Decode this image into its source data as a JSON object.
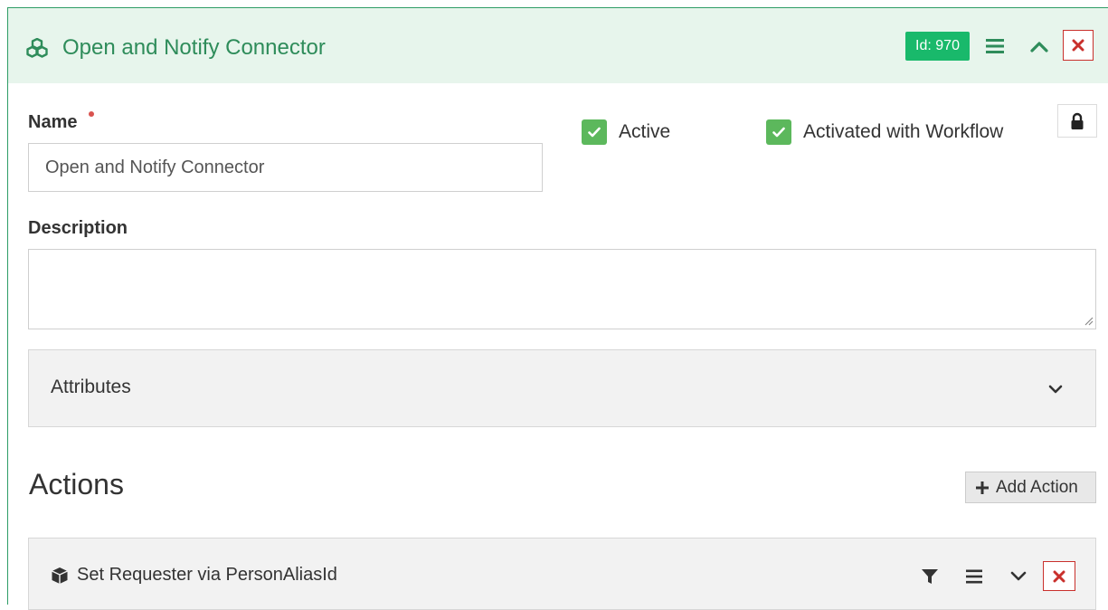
{
  "header": {
    "title": "Open and Notify Connector",
    "id_badge": "Id: 970",
    "icon": "cubes-icon",
    "accent_color": "#2e8c5a",
    "badge_color": "#19b96b"
  },
  "form": {
    "name_label": "Name",
    "name_value": "Open and Notify Connector",
    "active_label": "Active",
    "active_checked": true,
    "activated_label": "Activated with Workflow",
    "activated_checked": true,
    "description_label": "Description",
    "description_value": ""
  },
  "attributes": {
    "title": "Attributes"
  },
  "actions": {
    "heading": "Actions",
    "add_label": "Add Action",
    "items": [
      {
        "title": "Set Requester via PersonAliasId",
        "icon": "cube-icon"
      }
    ]
  }
}
